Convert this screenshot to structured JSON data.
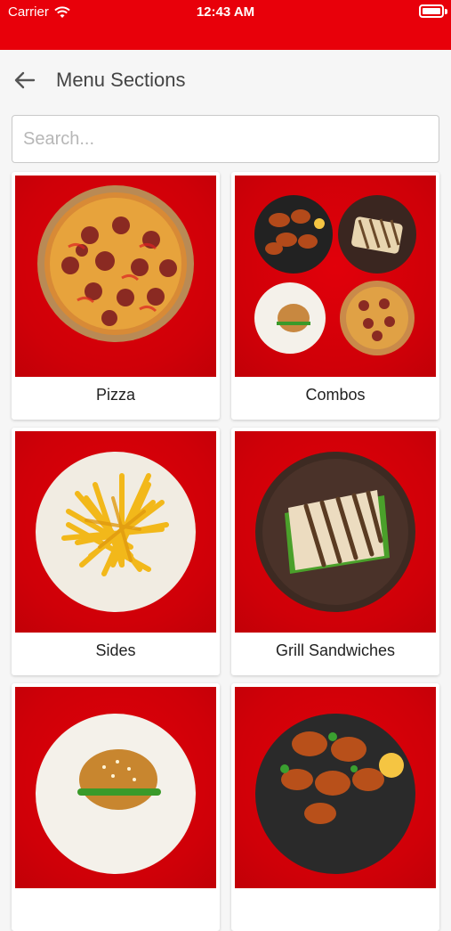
{
  "status_bar": {
    "carrier": "Carrier",
    "time": "12:43 AM"
  },
  "nav": {
    "title": "Menu Sections"
  },
  "search": {
    "placeholder": "Search...",
    "value": ""
  },
  "sections": [
    {
      "label": "Pizza",
      "icon": "pizza"
    },
    {
      "label": "Combos",
      "icon": "combo"
    },
    {
      "label": "Sides",
      "icon": "fries"
    },
    {
      "label": "Grill Sandwiches",
      "icon": "sandwich"
    },
    {
      "label": "",
      "icon": "burger"
    },
    {
      "label": "",
      "icon": "chicken"
    }
  ],
  "colors": {
    "brand": "#e8000a",
    "card_bg": "#d3000a"
  }
}
